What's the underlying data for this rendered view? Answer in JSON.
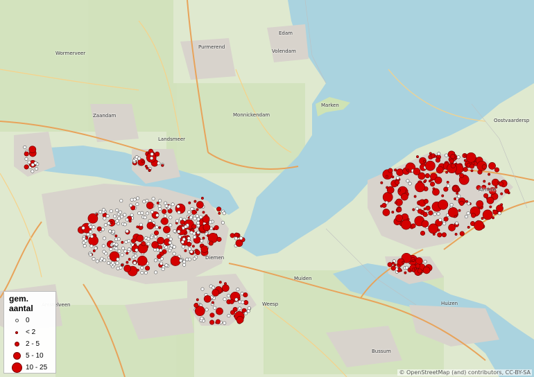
{
  "colors": {
    "land": "#dfe9cf",
    "urban": "#d8d3cc",
    "water": "#aad3df",
    "marker_fill": "#d40000",
    "marker_stroke": "#7a0000",
    "zero_fill": "#ffffff",
    "zero_stroke": "#555555"
  },
  "legend": {
    "title": "gem. aantal",
    "items": [
      {
        "label": "0",
        "class": "zero"
      },
      {
        "label": "< 2",
        "class": "lt2"
      },
      {
        "label": "2 - 5",
        "class": "2-5"
      },
      {
        "label": "5 - 10",
        "class": "5-10"
      },
      {
        "label": "10 - 25",
        "class": "10-25"
      }
    ]
  },
  "attribution": "© OpenStreetMap (and) contributors, CC-BY-SA",
  "places": {
    "wormerveer": "Wormerveer",
    "purmerend": "Purmerend",
    "edam": "Edam",
    "volendam": "Volendam",
    "zaandam": "Zaandam",
    "monnickendam": "Monnickendam",
    "marken": "Marken",
    "landsmeer": "Landsmeer",
    "oostvaarders": "Oostvaardersp",
    "amstelveen": "Amstelveen",
    "weesp": "Weesp",
    "muiden": "Muiden",
    "huizen": "Huizen",
    "bussum": "Bussum",
    "almere": "Almere",
    "diemen": "Diemen"
  }
}
